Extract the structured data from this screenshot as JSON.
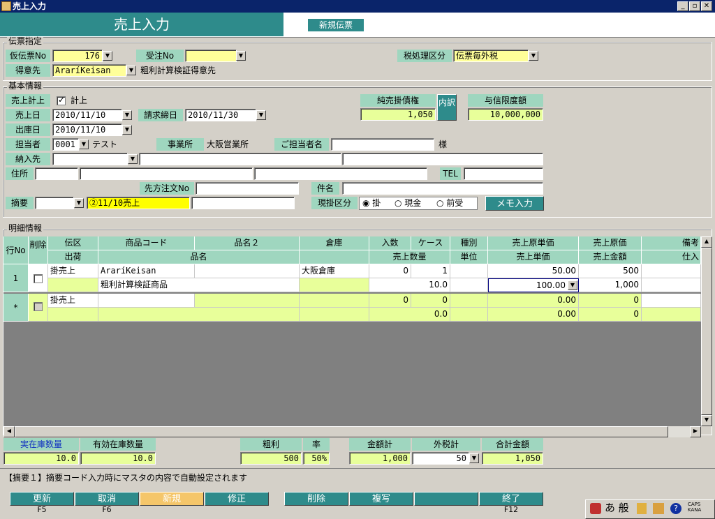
{
  "window": {
    "title": "売上入力",
    "min": "_",
    "max": "▫",
    "close": "✕"
  },
  "header": {
    "title": "売上入力",
    "new_slip": "新規伝票"
  },
  "slip": {
    "group": "伝票指定",
    "temp_no_label": "仮伝票No",
    "temp_no": "176",
    "order_no_label": "受注No",
    "order_no": "",
    "tax_label": "税処理区分",
    "tax": "伝票毎外税",
    "customer_label": "得意先",
    "customer_code": "AraríKeisan",
    "customer_name": "粗利計算検証得意先"
  },
  "basic": {
    "group": "基本情報",
    "sales_post_label": "売上計上",
    "sales_post_check": "計上",
    "sales_date_label": "売上日",
    "sales_date": "2010/11/10",
    "billing_label": "請求締日",
    "billing_date": "2010/11/30",
    "ship_date_label": "出庫日",
    "ship_date": "2010/11/10",
    "staff_label": "担当者",
    "staff_code": "0001",
    "staff_name": "テスト",
    "office_label": "事業所",
    "office": "大阪営業所",
    "contact_label": "ご担当者名",
    "contact": "",
    "honorific": "様",
    "delivery_label": "納入先",
    "address_label": "住所",
    "tel_label": "TEL",
    "client_order_label": "先方注文No",
    "subject_label": "件名",
    "memo_label": "摘要",
    "memo": "②11/10売上",
    "pay_label": "現掛区分",
    "pay_options": [
      "掛",
      "現金",
      "前受"
    ],
    "memo_btn": "メモ入力",
    "ar_label": "純売掛債権",
    "ar_value": "1,050",
    "ar_btn": "内訳",
    "credit_label": "与信限度額",
    "credit_value": "10,000,000"
  },
  "detail": {
    "group": "明細情報",
    "head1": [
      "伝区",
      "商品コード",
      "品名２",
      "倉庫",
      "入数",
      "ケース",
      "種別",
      "売上原単価",
      "売上原価",
      "備考"
    ],
    "head2": [
      "出荷",
      "品名",
      "売上数量",
      "単位",
      "売上単価",
      "売上金額",
      "仕入"
    ],
    "rowno_label": "行No",
    "delete_label": "削除",
    "rows": [
      {
        "no": "1",
        "type": "掛売上",
        "code": "AraríKeisan",
        "name2": "",
        "warehouse": "大阪倉庫",
        "per": "0",
        "case": "1",
        "kind": "",
        "cost_unit": "50.00",
        "cost": "500",
        "item": "粗利計算検証商品",
        "qty": "10.0",
        "unit": "",
        "price": "100.00",
        "amount": "1,000"
      },
      {
        "no": "*",
        "type": "掛売上",
        "code": "",
        "name2": "",
        "warehouse": "",
        "per": "0",
        "case": "0",
        "kind": "",
        "cost_unit": "0.00",
        "cost": "0",
        "item": "",
        "qty": "0.0",
        "unit": "",
        "price": "0.00",
        "amount": "0"
      }
    ]
  },
  "summary": {
    "stock_label": "実在庫数量",
    "stock": "10.0",
    "avail_label": "有効在庫数量",
    "avail": "10.0",
    "gross_label": "粗利",
    "gross": "500",
    "rate_label": "率",
    "rate": "50%",
    "total_label": "金額計",
    "total": "1,000",
    "tax_label": "外税計",
    "tax": "50",
    "grand_label": "合計金額",
    "grand": "1,050"
  },
  "status_msg": "【摘要１】摘要コード入力時にマスタの内容で自動設定されます",
  "fkeys": [
    {
      "label": "更新",
      "key": "F5"
    },
    {
      "label": "取消",
      "key": "F6"
    },
    {
      "label": "新規",
      "key": ""
    },
    {
      "label": "修正",
      "key": ""
    },
    {
      "label": "削除",
      "key": ""
    },
    {
      "label": "複写",
      "key": ""
    },
    {
      "label": "",
      "key": ""
    },
    {
      "label": "終了",
      "key": "F12"
    }
  ],
  "ime": {
    "mode": "あ 般",
    "caps": "CAPS",
    "kana": "KANA"
  },
  "colors": {
    "teal": "#2e8b8b",
    "label": "#9fd6bf",
    "yellow": "#ffff99",
    "lime": "#e8ff9a"
  }
}
